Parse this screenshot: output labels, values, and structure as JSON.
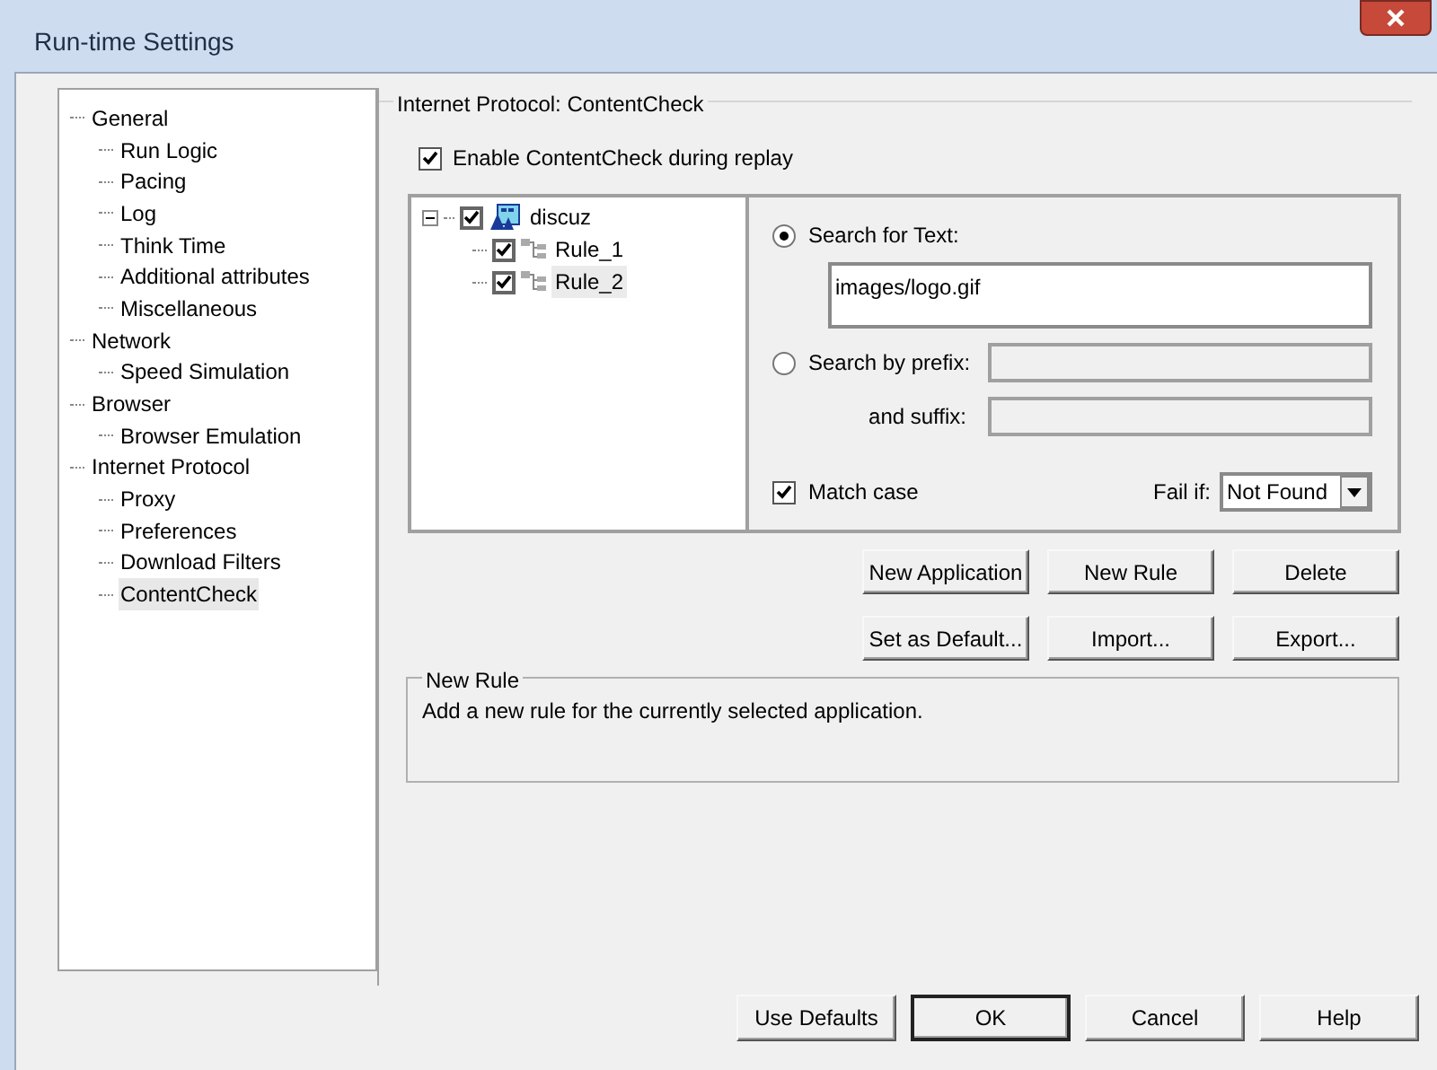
{
  "window": {
    "title": "Run-time Settings"
  },
  "nav_tree": [
    {
      "label": "General",
      "selected": false,
      "children": [
        {
          "label": "Run Logic",
          "selected": false
        },
        {
          "label": "Pacing",
          "selected": false
        },
        {
          "label": "Log",
          "selected": false
        },
        {
          "label": "Think Time",
          "selected": false
        },
        {
          "label": "Additional attributes",
          "selected": false
        },
        {
          "label": "Miscellaneous",
          "selected": false
        }
      ]
    },
    {
      "label": "Network",
      "selected": false,
      "children": [
        {
          "label": "Speed Simulation",
          "selected": false
        }
      ]
    },
    {
      "label": "Browser",
      "selected": false,
      "children": [
        {
          "label": "Browser Emulation",
          "selected": false
        }
      ]
    },
    {
      "label": "Internet Protocol",
      "selected": false,
      "children": [
        {
          "label": "Proxy",
          "selected": false
        },
        {
          "label": "Preferences",
          "selected": false
        },
        {
          "label": "Download Filters",
          "selected": false
        },
        {
          "label": "ContentCheck",
          "selected": true
        }
      ]
    }
  ],
  "group_title": "Internet Protocol: ContentCheck",
  "enable_checkbox": {
    "label": "Enable ContentCheck during replay",
    "checked": true
  },
  "rules_tree": [
    {
      "label": "discuz",
      "checked": true,
      "selected": false,
      "expanded": true,
      "children": [
        {
          "label": "Rule_1",
          "checked": true,
          "selected": false
        },
        {
          "label": "Rule_2",
          "checked": true,
          "selected": true
        }
      ]
    }
  ],
  "search_options": [
    {
      "label": "Search for Text:",
      "selected": true
    },
    {
      "label": "Search by prefix:",
      "selected": false
    }
  ],
  "text_field": {
    "value": "images/logo.gif"
  },
  "prefix_field": {
    "disabled": true
  },
  "suffix_label": "and suffix:",
  "suffix_field": {
    "disabled": true
  },
  "match_case": {
    "label": "Match case",
    "checked": true
  },
  "fail_if": {
    "label": "Fail if:",
    "value": "Not Found"
  },
  "action_buttons": [
    {
      "label": "New Application"
    },
    {
      "label": "New Rule"
    },
    {
      "label": "Delete"
    },
    {
      "label": "Set as Default..."
    },
    {
      "label": "Import..."
    },
    {
      "label": "Export..."
    }
  ],
  "description": {
    "title": "New Rule",
    "text": "Add a new rule for the currently selected application."
  },
  "dialog_buttons": [
    {
      "label": "Use Defaults",
      "default": false
    },
    {
      "label": "OK",
      "default": true
    },
    {
      "label": "Cancel",
      "default": false
    },
    {
      "label": "Help",
      "default": false
    }
  ]
}
